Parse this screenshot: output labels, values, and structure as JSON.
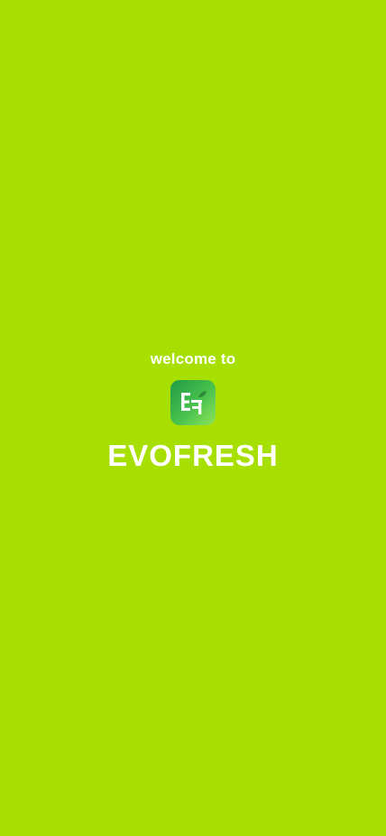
{
  "splash": {
    "welcome_text": "welcome to",
    "brand_name": "EVOFRESH",
    "logo_icon": "evofresh-logo-icon",
    "background_color": "#a6df00",
    "text_color": "#ffffff",
    "logo_gradient": [
      "#1f9b44",
      "#8fe35a"
    ]
  }
}
